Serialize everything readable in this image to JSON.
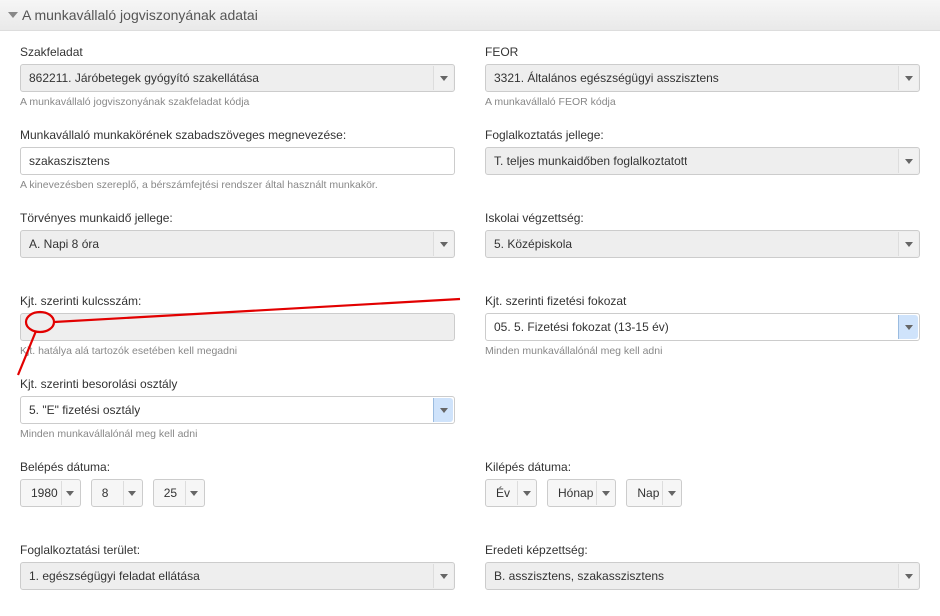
{
  "panel": {
    "title": "A munkavállaló jogviszonyának adatai"
  },
  "left": {
    "szakfeladat": {
      "label": "Szakfeladat",
      "value": "862211. Járóbetegek gyógyító szakellátása",
      "help": "A munkavállaló jogviszonyának szakfeladat kódja"
    },
    "munkakor": {
      "label": "Munkavállaló munkakörének szabadszöveges megnevezése:",
      "value": "szakaszisztens",
      "help": "A kinevezésben szereplő, a bérszámfejtési rendszer által használt munkakör."
    },
    "torvenyes": {
      "label": "Törvényes munkaidő jellege:",
      "value": "A. Napi 8 óra"
    },
    "kulcsszam": {
      "label": "Kjt. szerinti kulcsszám:",
      "value": "",
      "help": "Kjt. hatálya alá tartozók esetében kell megadni"
    },
    "besorolas": {
      "label": "Kjt. szerinti besorolási osztály",
      "value": "5. \"E\" fizetési osztály",
      "help": "Minden munkavállalónál meg kell adni"
    },
    "belepes": {
      "label": "Belépés dátuma:",
      "year": "1980",
      "month": "8",
      "day": "25"
    },
    "fogterulet": {
      "label": "Foglalkoztatási terület:",
      "value": "1. egészségügyi feladat ellátása"
    }
  },
  "right": {
    "feor": {
      "label": "FEOR",
      "value": "3321. Általános egészségügyi asszisztens",
      "help": "A munkavállaló FEOR kódja"
    },
    "fogjel": {
      "label": "Foglalkoztatás jellege:",
      "value": "T. teljes munkaidőben foglalkoztatott"
    },
    "iskola": {
      "label": "Iskolai végzettség:",
      "value": "5. Középiskola"
    },
    "fizfok": {
      "label": "Kjt. szerinti fizetési fokozat",
      "value": "05. 5. Fizetési fokozat (13-15 év)",
      "help": "Minden munkavállalónál meg kell adni"
    },
    "kilepes": {
      "label": "Kilépés dátuma:",
      "year": "Év",
      "month": "Hónap",
      "day": "Nap"
    },
    "eredeti": {
      "label": "Eredeti képzettség:",
      "value": "B. asszisztens, szakasszisztens"
    }
  }
}
